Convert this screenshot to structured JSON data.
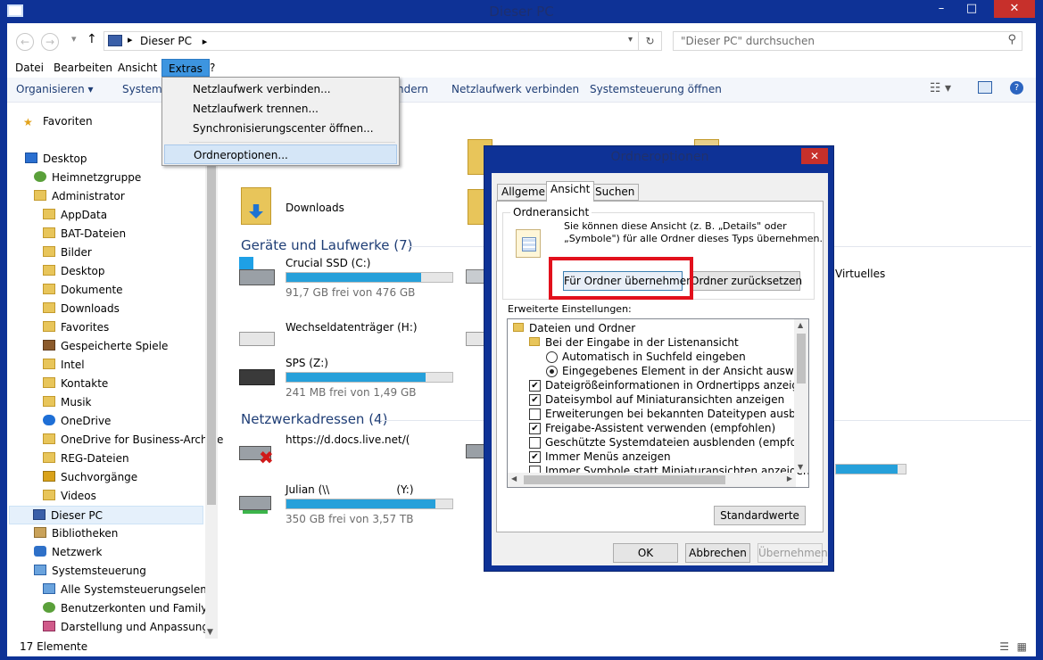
{
  "window": {
    "title": "Dieser PC",
    "controls": [
      "–",
      "□",
      "✕"
    ]
  },
  "address": {
    "path": "Dieser PC",
    "search_placeholder": "\"Dieser PC\" durchsuchen"
  },
  "menu": [
    "Datei",
    "Bearbeiten",
    "Ansicht",
    "Extras",
    "?"
  ],
  "commands": [
    "Organisieren ▾",
    "Systeme",
    "ndern",
    "Netzlaufwerk verbinden",
    "Systemsteuerung öffnen"
  ],
  "extras_menu": [
    "Netzlaufwerk verbinden...",
    "Netzlaufwerk trennen...",
    "Synchronisierungscenter öffnen...",
    "Ordneroptionen..."
  ],
  "sidebar": [
    {
      "label": "Favoriten"
    },
    {
      "label": "Desktop"
    },
    {
      "label": "Heimnetzgruppe"
    },
    {
      "label": "Administrator"
    },
    {
      "label": "AppData"
    },
    {
      "label": "BAT-Dateien"
    },
    {
      "label": "Bilder"
    },
    {
      "label": "Desktop"
    },
    {
      "label": "Dokumente"
    },
    {
      "label": "Downloads"
    },
    {
      "label": "Favorites"
    },
    {
      "label": "Gespeicherte Spiele"
    },
    {
      "label": "Intel"
    },
    {
      "label": "Kontakte"
    },
    {
      "label": "Musik"
    },
    {
      "label": "OneDrive"
    },
    {
      "label": "OneDrive for Business-Archive"
    },
    {
      "label": "REG-Dateien"
    },
    {
      "label": "Suchvorgänge"
    },
    {
      "label": "Videos"
    },
    {
      "label": "Dieser PC"
    },
    {
      "label": "Bibliotheken"
    },
    {
      "label": "Netzwerk"
    },
    {
      "label": "Systemsteuerung"
    },
    {
      "label": "Alle Systemsteuerungselement"
    },
    {
      "label": "Benutzerkonten und Family Sa"
    },
    {
      "label": "Darstellung und Anpassung"
    }
  ],
  "main": {
    "downloads_label": "Downloads",
    "group_devices": "Geräte und Laufwerke (7)",
    "group_network": "Netzwerkadressen (4)",
    "virtuelles": "Virtuelles",
    "drives": [
      {
        "name": "Crucial SSD (C:)",
        "free": "91,7 GB frei von 476 GB",
        "used_fraction": 0.81
      },
      {
        "name": "Wechseldatenträger (H:)",
        "free": "",
        "used_fraction": null
      },
      {
        "name": "SPS (Z:)",
        "free": "241 MB frei von 1,49 GB",
        "used_fraction": 0.84
      },
      {
        "name": "https://d.docs.live.net/(",
        "free": "",
        "used_fraction": null
      },
      {
        "name": "Julian (\\\\",
        "name2": "(Y:)",
        "free": "350 GB frei von 3,57 TB",
        "used_fraction": 0.9
      }
    ]
  },
  "status": {
    "count": "17 Elemente"
  },
  "dialog": {
    "title": "Ordneroptionen",
    "tabs": [
      "Allgemein",
      "Ansicht",
      "Suchen"
    ],
    "group_title": "Ordneransicht",
    "group_text1": "Sie können diese Ansicht (z. B. „Details\" oder",
    "group_text2": "„Symbole\") für alle Ordner dieses Typs übernehmen.",
    "btn_apply_folders": "Für Ordner übernehmen",
    "btn_reset_folders": "Ordner zurücksetzen",
    "advanced_label": "Erweiterte Einstellungen:",
    "tree": [
      {
        "type": "folder",
        "label": "Dateien und Ordner",
        "checked": null
      },
      {
        "type": "folder",
        "label": "Bei der Eingabe in der Listenansicht",
        "checked": null
      },
      {
        "type": "radio",
        "label": "Automatisch in Suchfeld eingeben",
        "checked": false
      },
      {
        "type": "radio",
        "label": "Eingegebenes Element in der Ansicht auswählen",
        "checked": true
      },
      {
        "type": "check",
        "label": "Dateigrößeinformationen in Ordnertipps anzeigen",
        "checked": true
      },
      {
        "type": "check",
        "label": "Dateisymbol auf Miniaturansichten anzeigen",
        "checked": true
      },
      {
        "type": "check",
        "label": "Erweiterungen bei bekannten Dateitypen ausblenden",
        "checked": false
      },
      {
        "type": "check",
        "label": "Freigabe-Assistent verwenden (empfohlen)",
        "checked": true
      },
      {
        "type": "check",
        "label": "Geschützte Systemdateien ausblenden (empfohlen)",
        "checked": false
      },
      {
        "type": "check",
        "label": "Immer Menüs anzeigen",
        "checked": true
      },
      {
        "type": "check",
        "label": "Immer Symbole statt Miniaturansichten anzeigen",
        "checked": false
      }
    ],
    "btn_defaults": "Standardwerte",
    "btn_ok": "OK",
    "btn_cancel": "Abbrechen",
    "btn_apply": "Übernehmen"
  }
}
